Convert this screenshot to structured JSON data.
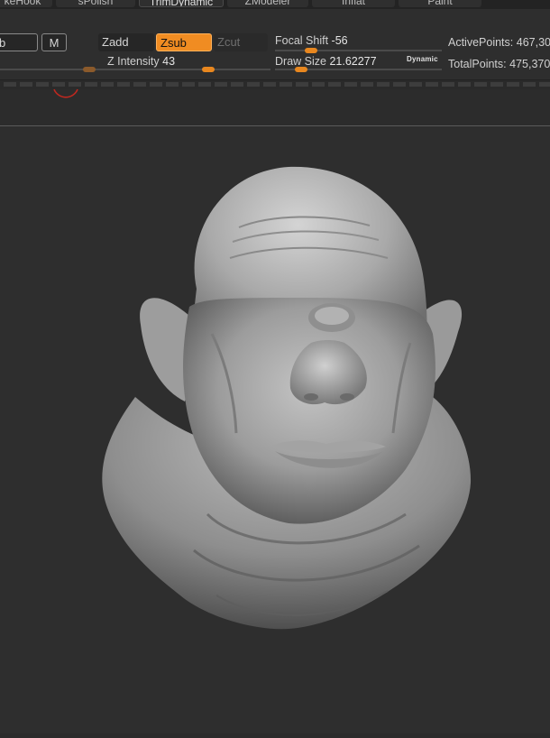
{
  "brush_tabs": [
    {
      "label": "keHook"
    },
    {
      "label": "sPolish"
    },
    {
      "label": "TrimDynamic",
      "active": true
    },
    {
      "label": "ZModeler"
    },
    {
      "label": "Inflat"
    },
    {
      "label": "Paint"
    }
  ],
  "toolbar": {
    "rgb_partial": "b",
    "m_label": "M",
    "zadd_label": "Zadd",
    "zsub_label": "Zsub",
    "zcut_label": "Zcut",
    "z_intensity_label": "Z Intensity",
    "z_intensity_value": "43",
    "focal_shift_label": "Focal Shift",
    "focal_shift_value": "-56",
    "draw_size_label": "Draw Size",
    "draw_size_value": "21.62277",
    "dynamic_label": "Dynamic"
  },
  "stats": {
    "active_points_label": "ActivePoints:",
    "active_points_value": "467,30",
    "total_points_label": "TotalPoints:",
    "total_points_value": "475,370"
  },
  "colors": {
    "accent": "#f08c22",
    "background": "#2e2e2e",
    "model": "#b9b9b9",
    "brush_cursor": "#c0281f"
  },
  "icons": {
    "brush_cursor": "brush-cursor-icon",
    "sculpt": "sculpted-head-model"
  }
}
